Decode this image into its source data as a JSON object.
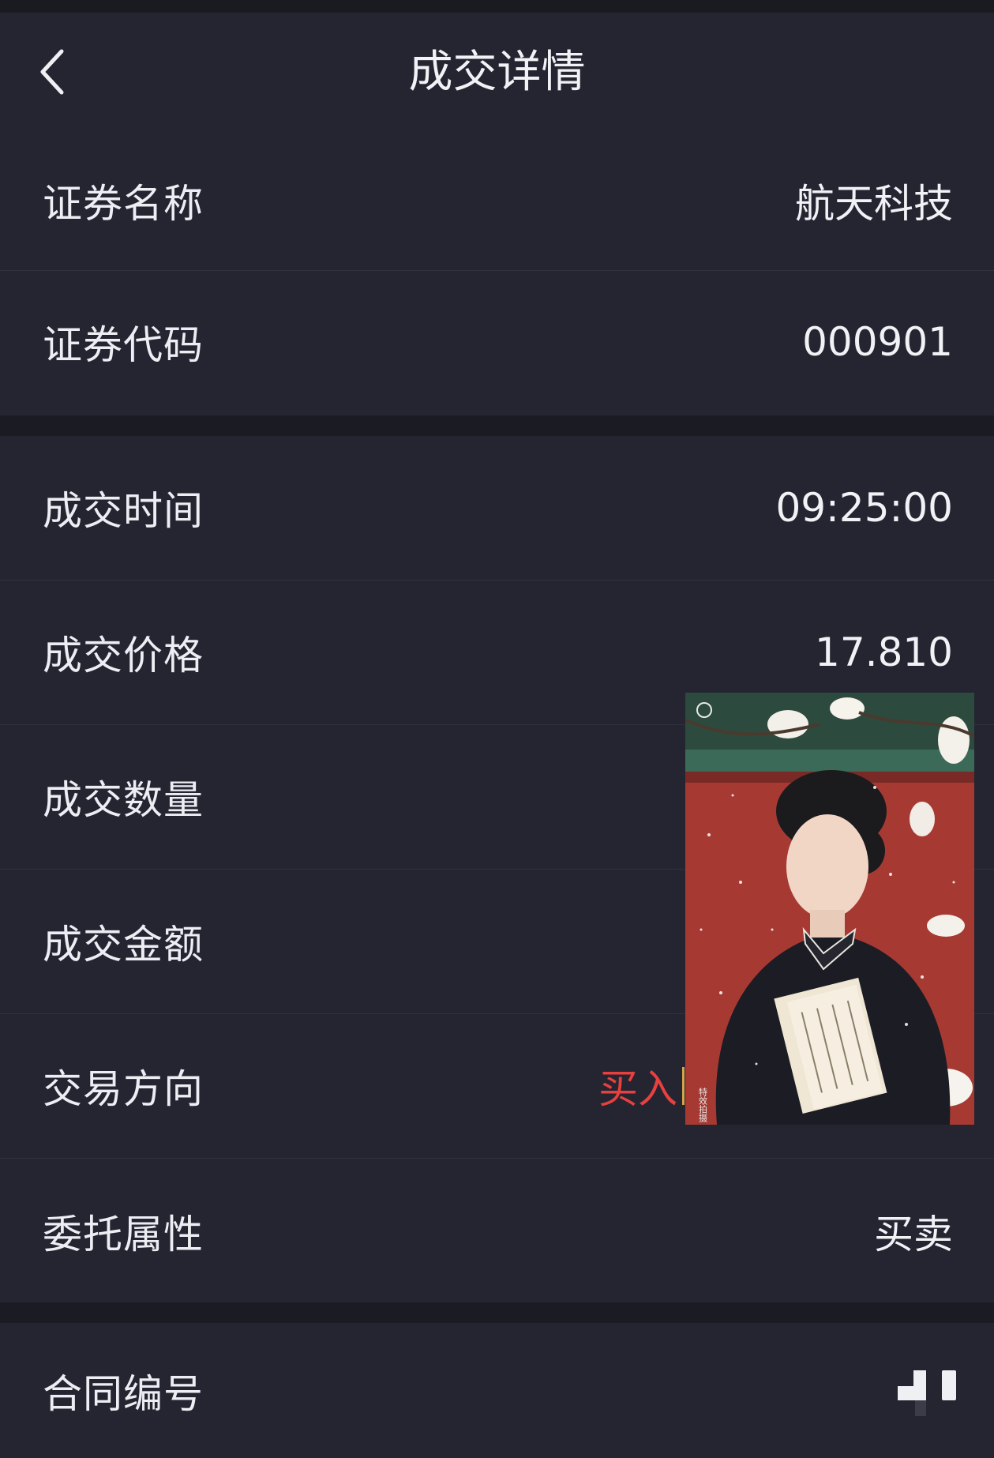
{
  "header": {
    "title": "成交详情"
  },
  "security": {
    "name_label": "证券名称",
    "name_value": "航天科技",
    "code_label": "证券代码",
    "code_value": "000901"
  },
  "trade": {
    "time_label": "成交时间",
    "time_value": "09:25:00",
    "price_label": "成交价格",
    "price_value": "17.810",
    "quantity_label": "成交数量",
    "amount_label": "成交金额",
    "direction_label": "交易方向",
    "direction_value": "买入",
    "attribute_label": "委托属性",
    "attribute_value": "买卖"
  },
  "contract": {
    "number_label": "合同编号"
  },
  "overlay": {
    "caption": "特效拍摄"
  },
  "colors": {
    "background": "#1b1c23",
    "panel": "#242531",
    "text": "#eceef3",
    "buy_red": "#e8403e"
  }
}
